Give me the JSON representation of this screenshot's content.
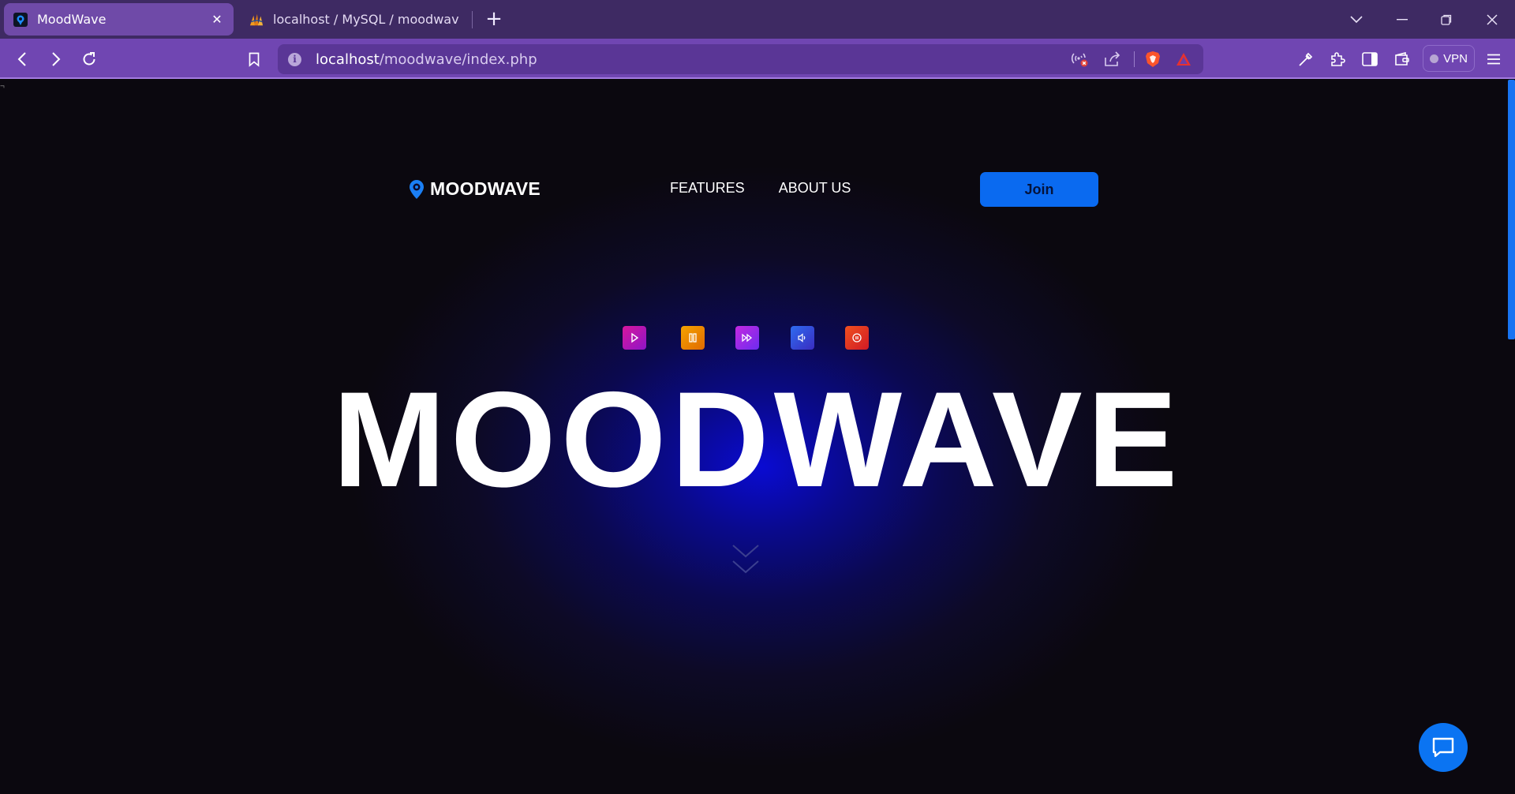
{
  "browser": {
    "tabs": [
      {
        "title": "MoodWave",
        "active": true,
        "favicon": "moodwave-logo-icon"
      },
      {
        "title": "localhost / MySQL / moodwave / use",
        "active": false,
        "favicon": "phpmyadmin-icon"
      }
    ],
    "address": {
      "host": "localhost",
      "path": "/moodwave/index.php"
    },
    "vpn_label": "VPN",
    "accent": "#6f4aa8"
  },
  "page": {
    "brand": "MOODWAVE",
    "nav": {
      "features": "FEATURES",
      "about": "ABOUT US"
    },
    "join_label": "Join",
    "hero_title": "MOODWAVE",
    "player_icons": [
      "play-icon",
      "pause-icon",
      "fast-forward-icon",
      "volume-icon",
      "stop-icon"
    ],
    "colors": {
      "primary": "#0a6af0",
      "background": "#0b080f",
      "glow": "#0a0bd2"
    }
  }
}
